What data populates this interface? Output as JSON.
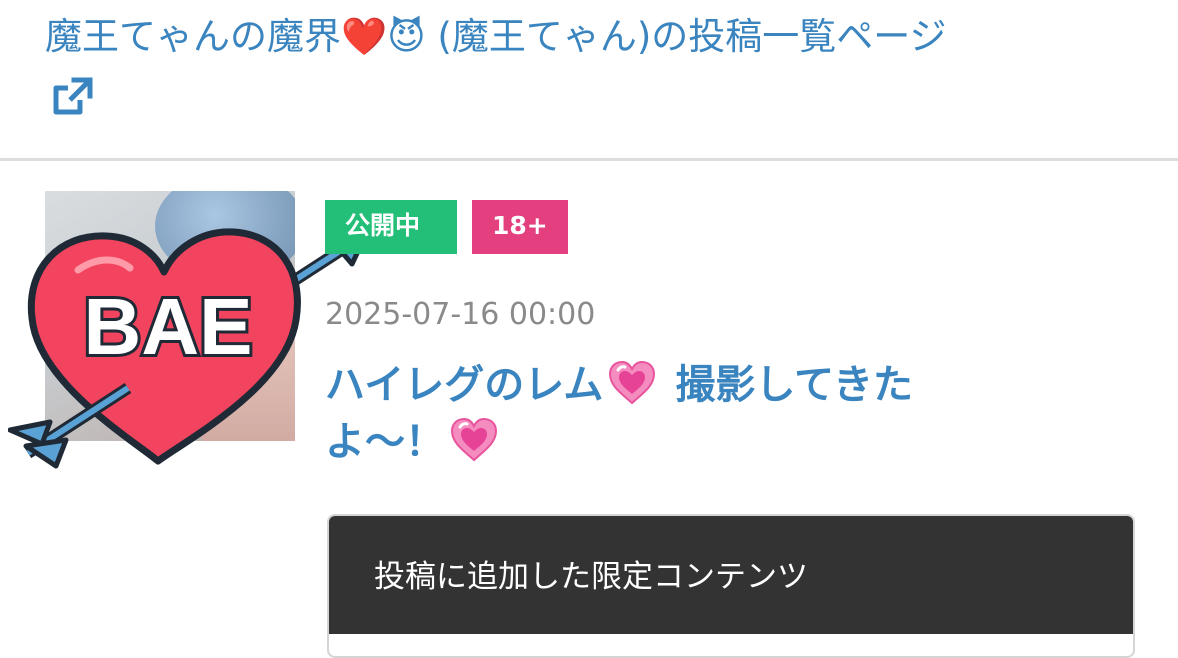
{
  "header": {
    "title": "魔王てゃんの魔界❤️😈 (魔王てゃん)の投稿一覧ページ",
    "external_link_icon": "external-link-icon"
  },
  "post": {
    "status_badge": "公開中",
    "age_badge": "18+",
    "date": "2025-07-16 00:00",
    "title_part1": "ハイレグのレム",
    "title_part2": "撮影してきたよ〜！",
    "title_emoji": "growing-heart",
    "sticker_text": "BAE",
    "colors": {
      "link": "#3a84bf",
      "public": "#23bf78",
      "adult": "#e4407f",
      "locked_header": "#333333"
    }
  },
  "locked": {
    "header": "投稿に追加した限定コンテンツ"
  }
}
